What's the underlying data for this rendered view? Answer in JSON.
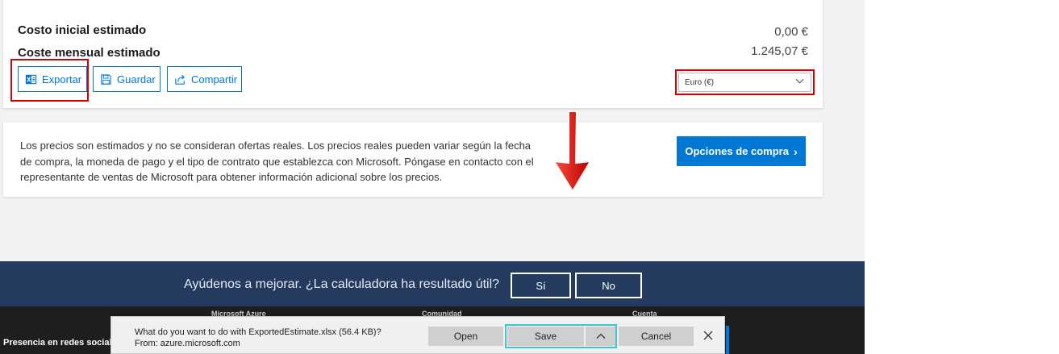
{
  "totals": {
    "initial_label": "Costo inicial estimado",
    "initial_value": "0,00 €",
    "monthly_label": "Coste mensual estimado",
    "monthly_value": "1.245,07 €"
  },
  "actions": {
    "export_label": "Exportar",
    "save_label": "Guardar",
    "share_label": "Compartir",
    "export_icon": "excel-icon",
    "save_icon": "floppy-icon",
    "share_icon": "share-icon"
  },
  "currency": {
    "selected": "Euro (€)"
  },
  "info": {
    "disclaimer": "Los precios son estimados y no se consideran ofertas reales. Los precios reales pueden variar según la fecha de compra, la moneda de pago y el tipo de contrato que establezca con Microsoft. Póngase en contacto con el representante de ventas de Microsoft para obtener información adicional sobre los precios.",
    "buy_options_label": "Opciones de compra",
    "buy_arrow": "›"
  },
  "feedback": {
    "question": "Ayúdenos a mejorar. ¿La calculadora ha resultado útil?",
    "yes_label": "Sí",
    "no_label": "No"
  },
  "footer": {
    "headings": [
      "Microsoft Azure",
      "Comunidad",
      "Cuenta"
    ],
    "social_label": "Presencia en redes sociale"
  },
  "download_bar": {
    "question": "What do you want to do with ExportedEstimate.xlsx (56.4 KB)?",
    "source": "From: azure.microsoft.com",
    "open_label": "Open",
    "save_label": "Save",
    "cancel_label": "Cancel"
  },
  "colors": {
    "accent": "#0078d4",
    "highlight": "#d20000",
    "banner": "#243a5e",
    "footer": "#1e1e1e",
    "focus": "#3fc4d6"
  }
}
